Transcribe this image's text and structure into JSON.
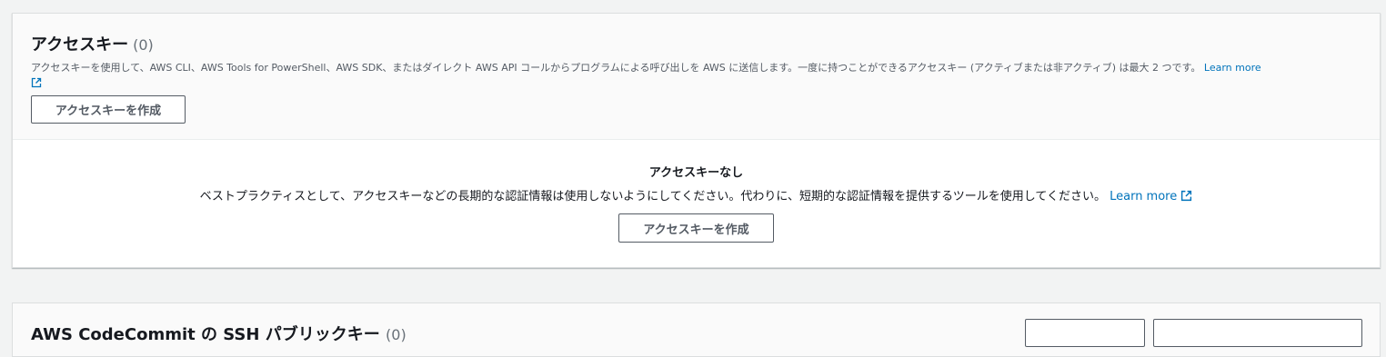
{
  "access_keys": {
    "title": "アクセスキー",
    "count": "(0)",
    "description": "アクセスキーを使用して、AWS CLI、AWS Tools for PowerShell、AWS SDK、またはダイレクト AWS API コールからプログラムによる呼び出しを AWS に送信します。一度に持つことができるアクセスキー (アクティブまたは非アクティブ) は最大 2 つです。",
    "learn_more": "Learn more",
    "create_button": "アクセスキーを作成",
    "empty_title": "アクセスキーなし",
    "empty_text": "ベストプラクティスとして、アクセスキーなどの長期的な認証情報は使用しないようにしてください。代わりに、短期的な認証情報を提供するツールを使用してください。",
    "empty_learn_more": "Learn more",
    "empty_create_button": "アクセスキーを作成"
  },
  "next_panel": {
    "title": "AWS CodeCommit の SSH パブリックキー",
    "count": "(0)"
  },
  "colors": {
    "link": "#0073bb",
    "page_background": "#f2f3f3",
    "header_background": "#fafafa",
    "button_border": "#545b64"
  },
  "icons": {
    "external_link": "external-link-icon"
  }
}
